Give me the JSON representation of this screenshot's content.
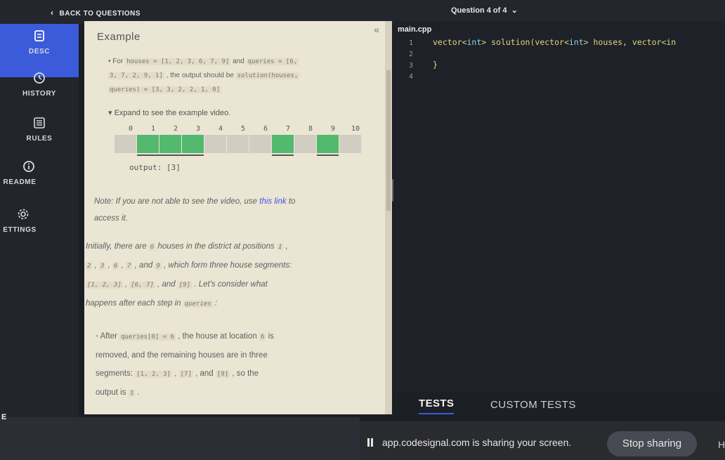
{
  "topbar": {
    "back_label": "BACK TO QUESTIONS",
    "question_selector": "Question 4 of 4"
  },
  "nav": {
    "items": [
      {
        "label": "DESC",
        "icon": "document-icon"
      },
      {
        "label": "HISTORY",
        "icon": "clock-icon"
      },
      {
        "label": "RULES",
        "icon": "list-icon"
      },
      {
        "label": "README",
        "icon": "info-icon"
      },
      {
        "label": "ETTINGS",
        "icon": "gear-icon"
      }
    ]
  },
  "description": {
    "title": "Example",
    "bullet_for": "For",
    "bullet_houses": "houses = [1, 2, 3, 6, 7, 9]",
    "bullet_and": "and",
    "bullet_queries": "queries = [6,",
    "bullet_line2_mono": "3, 7, 2, 9, 1]",
    "bullet_line2_text": ", the output should be",
    "bullet_line2_call": "solution(houses,",
    "bullet_line3": "queries) = [3, 3, 2, 2, 1, 0]",
    "expand_label": "Expand to see the example video.",
    "house_numbers": [
      "0",
      "1",
      "2",
      "3",
      "4",
      "5",
      "6",
      "7",
      "8",
      "9",
      "10"
    ],
    "occupied": [
      1,
      2,
      3,
      7,
      9
    ],
    "output_label": "output: [3]",
    "note_prefix": "Note: If you are not able to see the video, use",
    "note_link": "this link",
    "note_to": "to",
    "note_line2": "access it.",
    "p1_a": "Initially, there are",
    "p1_six": "6",
    "p1_b": "houses in the district at positions",
    "p1_one": "1",
    "p2_two": "2",
    "p2_three": "3",
    "p2_six": "6",
    "p2_seven": "7",
    "p2_and": ", and",
    "p2_nine": "9",
    "p2_text": ", which form three house segments:",
    "p3_s1": "[1, 2, 3]",
    "p3_s2": "[6, 7]",
    "p3_and": ", and",
    "p3_s3": "[9]",
    "p3_text": ". Let's consider what",
    "p4_text": "happens after each step in",
    "p4_queries": "queries",
    "p4_colon": ":",
    "b2_after": "After",
    "b2_q": "queries[0] = 6",
    "b2_text": ", the house at location",
    "b2_six": "6",
    "b2_is": "is",
    "b2_line2": "removed, and the remaining houses are in three",
    "b2_seg": "segments:",
    "b2_s1": "[1, 2, 3]",
    "b2_s2": "[7]",
    "b2_and": ", and",
    "b2_s3": "[9]",
    "b2_so": ", so the",
    "b2_out": "output is",
    "b2_three": "3"
  },
  "editor": {
    "filename": "main.cpp",
    "line_numbers": [
      "1",
      "2",
      "3",
      "4"
    ],
    "line1_a": "vector<",
    "line1_int": "int",
    "line1_b": "> solution(vector<",
    "line1_int2": "int",
    "line1_c": "> houses, vector<in",
    "line3": "}"
  },
  "tests_tabs": {
    "tests": "TESTS",
    "custom": "CUSTOM TESTS"
  },
  "share": {
    "message": "app.codesignal.com is sharing your screen.",
    "stop": "Stop sharing",
    "hide": "H"
  },
  "left_fragment": "E",
  "colors": {
    "accent": "#3b5bdb",
    "house_on": "#52b96e",
    "house_off": "#d1cdc3",
    "panel_bg": "#ebe5d4"
  }
}
